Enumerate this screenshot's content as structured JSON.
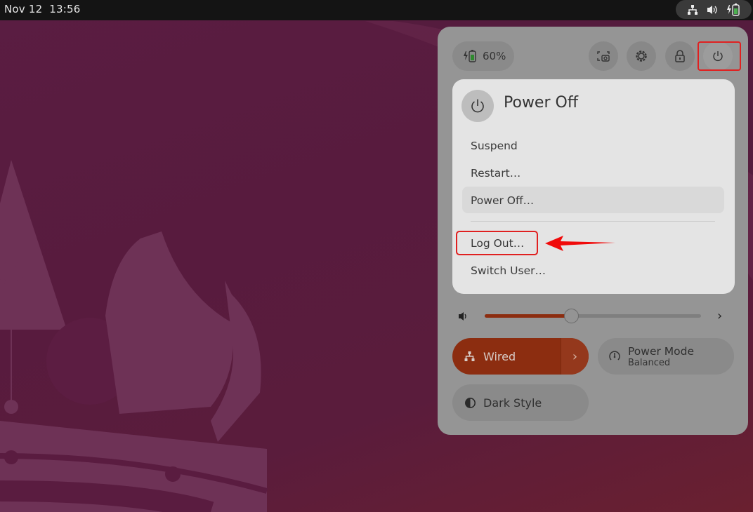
{
  "topbar": {
    "date": "Nov 12",
    "time": "13:56",
    "tray_icons": [
      "network-wired-icon",
      "volume-icon",
      "battery-charging-icon"
    ]
  },
  "quick_settings": {
    "battery": {
      "icon": "battery-charging-icon",
      "label": "60%"
    },
    "buttons": [
      {
        "name": "screenshot",
        "icon": "screenshot-icon"
      },
      {
        "name": "settings",
        "icon": "gear-icon"
      },
      {
        "name": "lock",
        "icon": "lock-icon"
      },
      {
        "name": "power",
        "icon": "power-icon"
      }
    ],
    "power_menu": {
      "title": "Power Off",
      "items": [
        {
          "label": "Suspend"
        },
        {
          "label": "Restart…"
        },
        {
          "label": "Power Off…",
          "highlighted": true
        },
        {
          "label": "Log Out…"
        },
        {
          "label": "Switch User…"
        }
      ]
    },
    "volume": {
      "level_percent": 40
    },
    "toggles": {
      "wired": {
        "label": "Wired",
        "active": true
      },
      "power_mode": {
        "label": "Power Mode",
        "value": "Balanced"
      },
      "dark_style": {
        "label": "Dark Style",
        "active": false
      }
    }
  },
  "colors": {
    "accent": "#8c2d10",
    "annotation": "#e02020",
    "battery_green": "#4caf50"
  }
}
